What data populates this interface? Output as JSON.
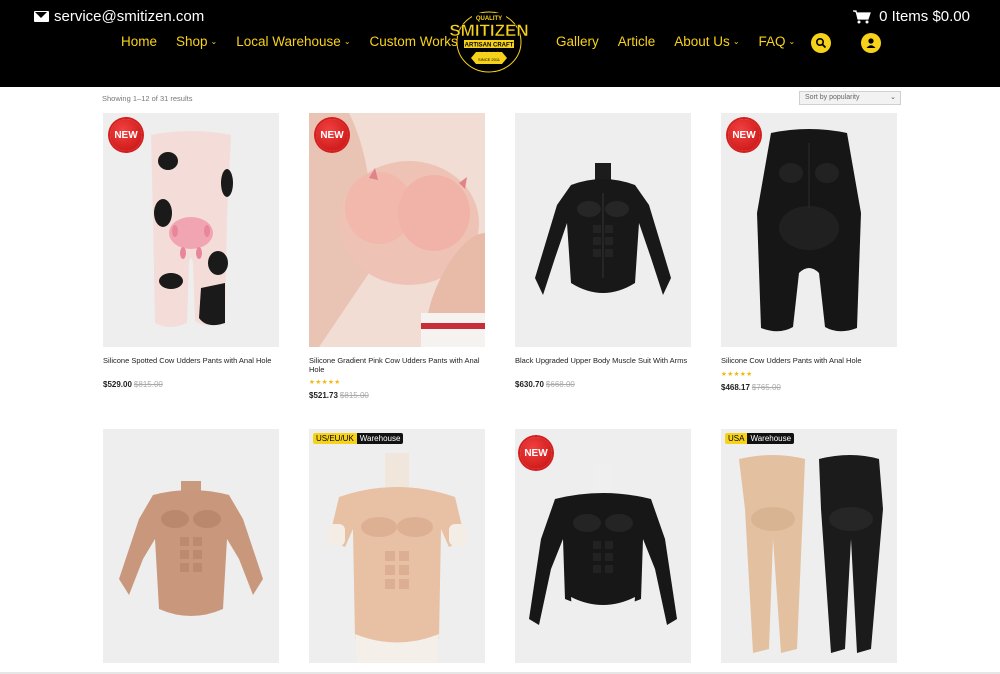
{
  "header": {
    "email": "service@smitizen.com",
    "cart_label": "0 Items $0.00",
    "nav_left": [
      {
        "label": "Home",
        "has_caret": false
      },
      {
        "label": "Shop",
        "has_caret": true
      },
      {
        "label": "Local Warehouse",
        "has_caret": true
      },
      {
        "label": "Custom Works",
        "has_caret": false
      }
    ],
    "nav_right": [
      {
        "label": "Gallery",
        "has_caret": false
      },
      {
        "label": "Article",
        "has_caret": false
      },
      {
        "label": "About Us",
        "has_caret": true
      },
      {
        "label": "FAQ",
        "has_caret": true
      }
    ],
    "logo": {
      "top": "QUALITY",
      "main": "SMITIZEN",
      "sub": "ARTISAN CRAFT",
      "since": "SINCE 2011"
    },
    "accent": "#f7d21a",
    "icons": {
      "search": "search-icon",
      "user": "user-icon",
      "cart": "cart-icon",
      "email": "envelope-icon"
    }
  },
  "toolbar": {
    "result_count": "Showing 1–12 of 31 results",
    "sort_selected": "Sort by popularity"
  },
  "products": [
    {
      "title": "Silicone Spotted Cow Udders Pants with Anal Hole",
      "price": "$529.00",
      "old_price": "$815.00",
      "rating": "",
      "badge": "NEW",
      "image": "cow-spotted-pants"
    },
    {
      "title": "Silicone Gradient Pink Cow Udders Pants with Anal Hole",
      "price": "$521.73",
      "old_price": "$815.00",
      "rating": "★★★★★",
      "badge": "NEW",
      "image": "gradient-pink-udders"
    },
    {
      "title": "Black Upgraded Upper Body Muscle Suit With Arms",
      "price": "$630.70",
      "old_price": "$668.00",
      "rating": "",
      "badge": "",
      "image": "black-muscle-suit"
    },
    {
      "title": "Silicone Cow Udders Pants with Anal Hole",
      "price": "$468.17",
      "old_price": "$765.00",
      "rating": "★★★★★",
      "badge": "NEW",
      "image": "black-udders-pants"
    },
    {
      "badge": "",
      "image": "tan-muscle-suit-arms"
    },
    {
      "badge_wh": [
        "US/EU/UK",
        "Warehouse"
      ],
      "image": "tan-muscle-chest"
    },
    {
      "badge": "NEW",
      "image": "black-muscle-suit-arms"
    },
    {
      "badge_wh": [
        "USA",
        "Warehouse"
      ],
      "image": "muscle-leg-pants"
    }
  ]
}
